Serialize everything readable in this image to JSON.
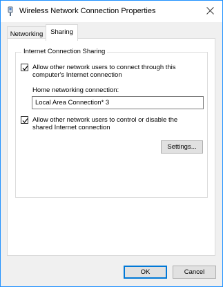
{
  "window": {
    "title": "Wireless Network Connection Properties",
    "accent": "#1e90ff"
  },
  "title_icon": "network-adapter-icon",
  "close_icon": "close-icon",
  "tabs": [
    {
      "label": "Networking",
      "selected": false
    },
    {
      "label": "Sharing",
      "selected": true
    }
  ],
  "sharing": {
    "group_title": "Internet Connection Sharing",
    "allow_connect": {
      "checked": true,
      "label_line1": "Allow other network users to connect through this",
      "label_line2": "computer's Internet connection"
    },
    "home_connection": {
      "label": "Home networking connection:",
      "value": "Local Area Connection* 3"
    },
    "allow_control": {
      "checked": true,
      "label_line1": "Allow other network users to control or disable the",
      "label_line2": "shared Internet connection"
    },
    "settings_label": "Settings..."
  },
  "footer": {
    "ok_label": "OK",
    "cancel_label": "Cancel"
  }
}
